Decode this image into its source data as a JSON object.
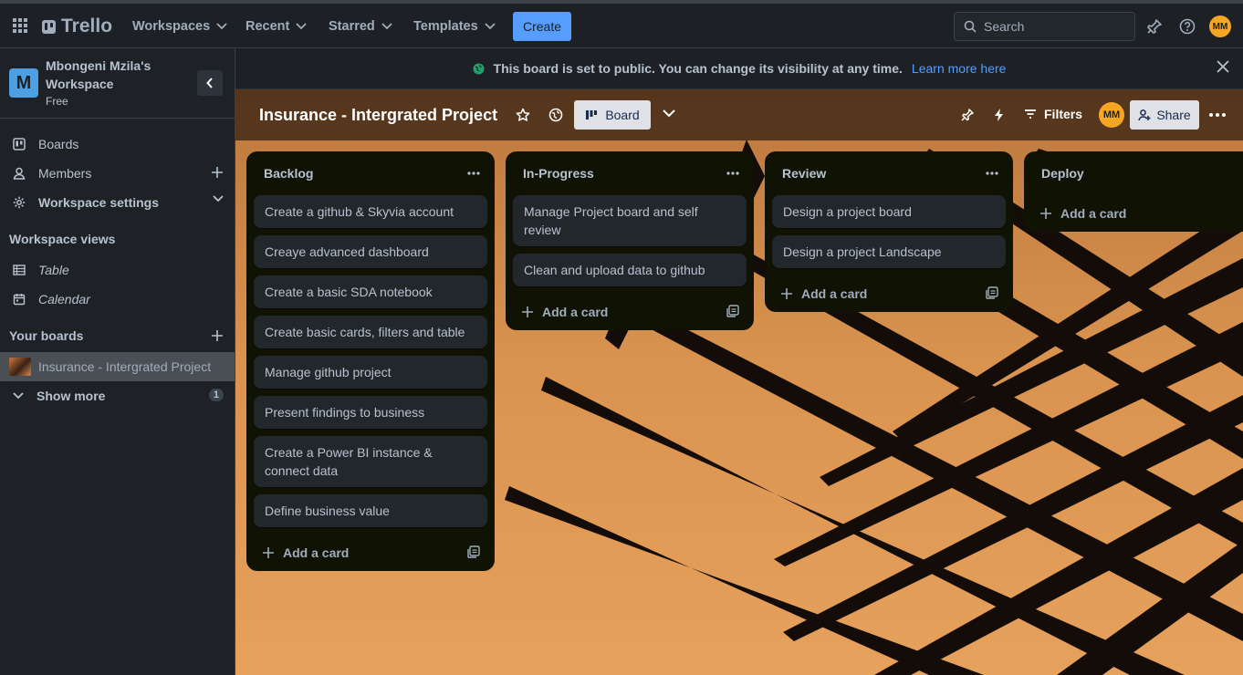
{
  "topbar": {
    "logo": "Trello",
    "nav": [
      "Workspaces",
      "Recent",
      "Starred",
      "Templates"
    ],
    "create_label": "Create",
    "search_placeholder": "Search",
    "avatar_initials": "MM"
  },
  "sidebar": {
    "workspace_initial": "M",
    "workspace_name": "Mbongeni Mzila's Workspace",
    "workspace_plan": "Free",
    "items": [
      {
        "label": "Boards",
        "icon": "board-icon"
      },
      {
        "label": "Members",
        "icon": "person-icon"
      },
      {
        "label": "Workspace settings",
        "icon": "gear-icon"
      }
    ],
    "views_heading": "Workspace views",
    "views": [
      {
        "label": "Table",
        "icon": "table-icon"
      },
      {
        "label": "Calendar",
        "icon": "calendar-icon"
      }
    ],
    "boards_heading": "Your boards",
    "boards": [
      {
        "label": "Insurance - Intergrated Project"
      }
    ],
    "show_more_label": "Show more",
    "show_more_count": "1"
  },
  "banner": {
    "text": "This board is set to public. You can change its visibility at any time.",
    "link": "Learn more here",
    "icon": "globe-icon"
  },
  "board": {
    "title": "Insurance - Intergrated Project",
    "view_label": "Board",
    "filters_label": "Filters",
    "share_label": "Share",
    "avatar_initials": "MM"
  },
  "lists": [
    {
      "title": "Backlog",
      "cards": [
        "Create a github & Skyvia account",
        "Creaye advanced dashboard",
        "Create a basic SDA notebook",
        "Create basic cards, filters and table",
        "Manage github project",
        "Present findings to business",
        "Create a Power BI instance & connect data",
        "Define business value"
      ],
      "add_label": "Add a card"
    },
    {
      "title": "In-Progress",
      "cards": [
        "Manage Project board and self review",
        "Clean and upload data to github"
      ],
      "add_label": "Add a card"
    },
    {
      "title": "Review",
      "cards": [
        "Design a project board",
        "Design a project Landscape"
      ],
      "add_label": "Add a card"
    },
    {
      "title": "Deploy",
      "cards": [],
      "add_label": "Add a card"
    }
  ],
  "colors": {
    "accent": "#579dff",
    "topbar_bg": "#1d2125",
    "list_bg": "#101204",
    "card_bg": "#22272b",
    "avatar": "#f5a623"
  }
}
